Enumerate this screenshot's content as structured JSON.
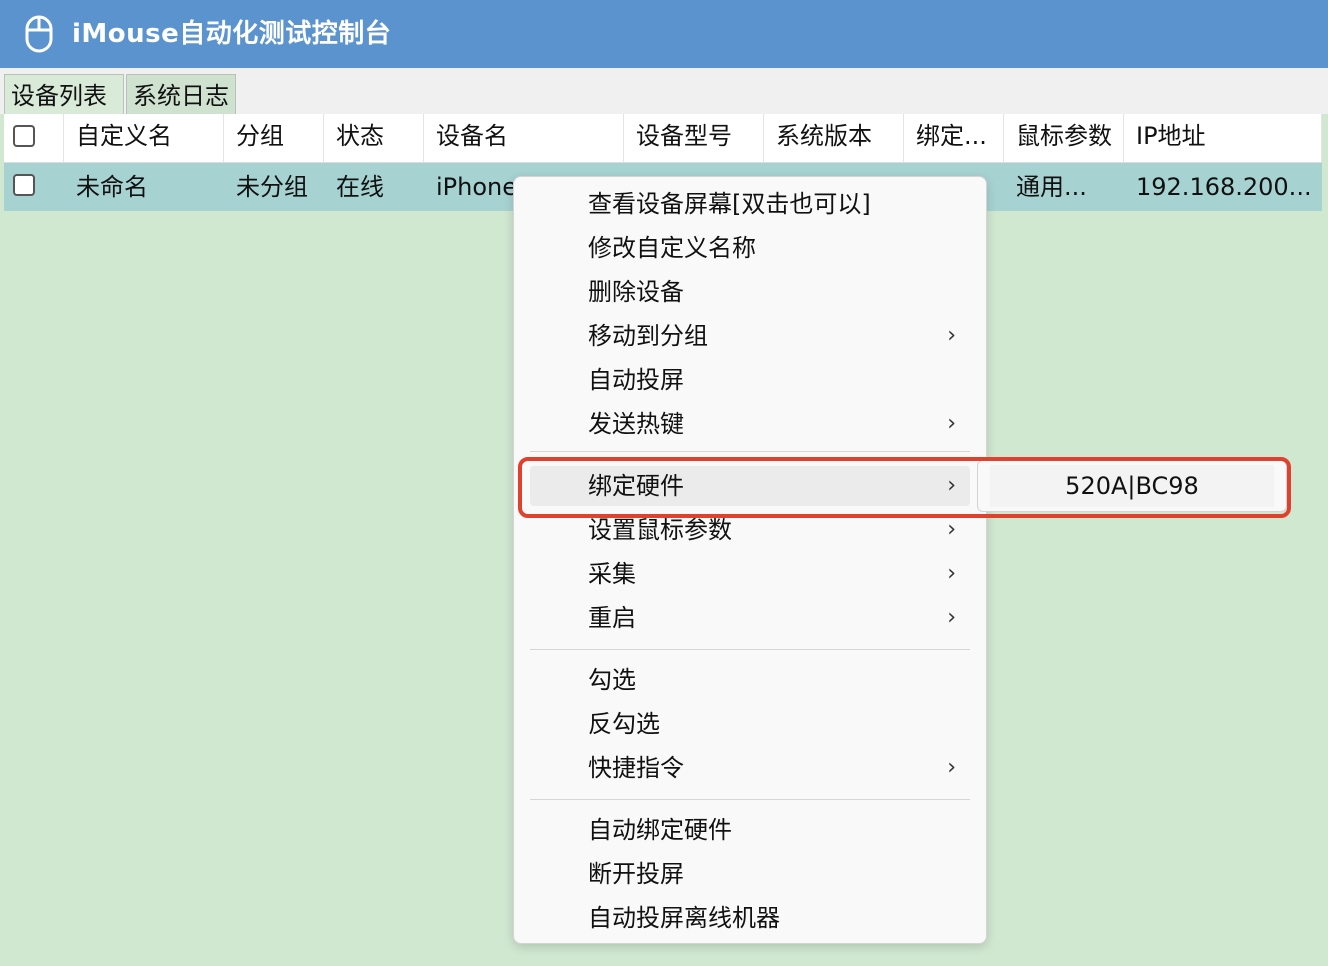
{
  "app": {
    "title": "iMouse自动化测试控制台",
    "icon": "mouse-icon",
    "title_bg": "#5b93cf"
  },
  "tabs": [
    {
      "label": "设备列表",
      "active": true
    },
    {
      "label": "系统日志",
      "active": false
    }
  ],
  "table": {
    "columns": [
      "自定义名",
      "分组",
      "状态",
      "设备名",
      "设备型号",
      "系统版本",
      "绑定...",
      "鼠标参数",
      "IP地址"
    ],
    "rows": [
      {
        "checked": false,
        "custom_name": "未命名",
        "group": "未分组",
        "status": "在线",
        "device_name": "iPhone",
        "model": "",
        "os_version": "",
        "binding": "",
        "mouse_params": "通用...",
        "ip": "192.168.200..."
      }
    ]
  },
  "context_menu": {
    "items": [
      {
        "label": "查看设备屏幕[双击也可以]",
        "submenu": false
      },
      {
        "label": "修改自定义名称",
        "submenu": false
      },
      {
        "label": "删除设备",
        "submenu": false
      },
      {
        "label": "移动到分组",
        "submenu": true
      },
      {
        "label": "自动投屏",
        "submenu": false
      },
      {
        "label": "发送热键",
        "submenu": true
      },
      {
        "label": "绑定硬件",
        "submenu": true,
        "highlighted": true
      },
      {
        "label": "设置鼠标参数",
        "submenu": true
      },
      {
        "label": "采集",
        "submenu": true
      },
      {
        "label": "重启",
        "submenu": true
      },
      {
        "label": "勾选",
        "submenu": false
      },
      {
        "label": "反勾选",
        "submenu": false
      },
      {
        "label": "快捷指令",
        "submenu": true
      },
      {
        "label": "自动绑定硬件",
        "submenu": false
      },
      {
        "label": "断开投屏",
        "submenu": false
      },
      {
        "label": "自动投屏离线机器",
        "submenu": false
      }
    ],
    "arrow_glyph": "›"
  },
  "submenu": {
    "items": [
      "520A|BC98"
    ]
  },
  "colors": {
    "background": "#d0e7d0",
    "selected_row": "#a7d2d2",
    "annotation_border": "#e0412f"
  }
}
